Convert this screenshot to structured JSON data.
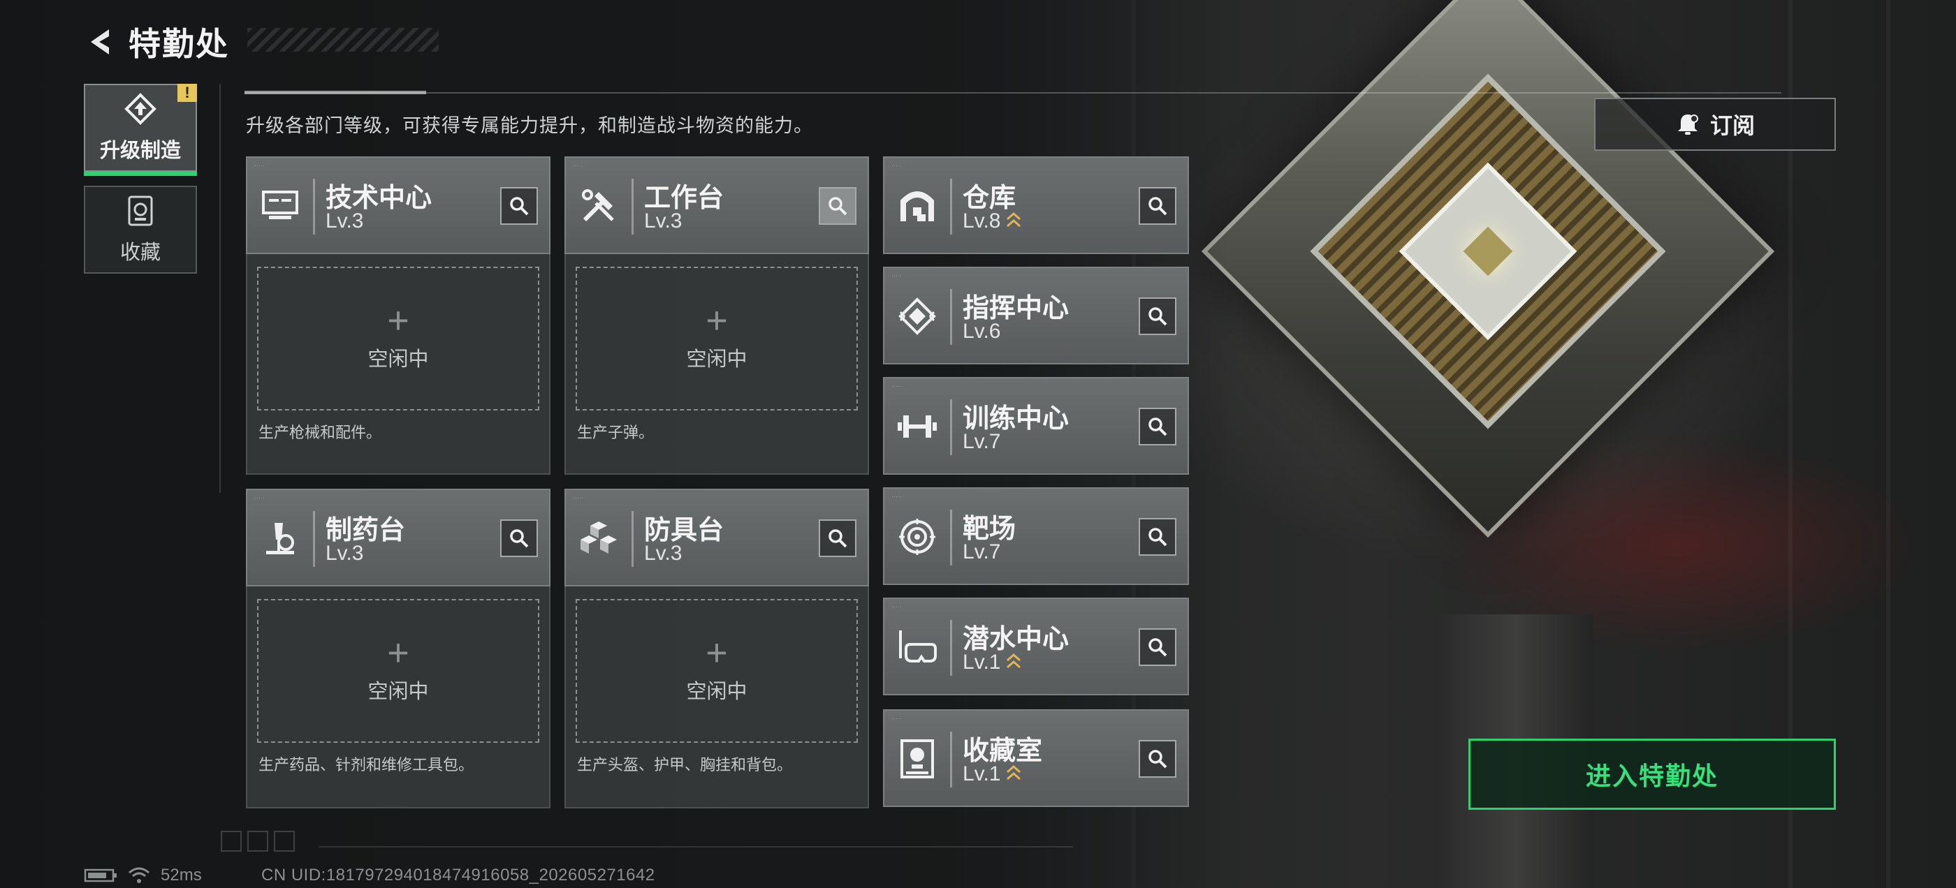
{
  "header": {
    "title": "特勤处"
  },
  "tabs": [
    {
      "label": "升级制造",
      "badge": "!"
    },
    {
      "label": "收藏"
    }
  ],
  "description": "升级各部门等级，可获得专属能力提升，和制造战斗物资的能力。",
  "subscribe_label": "订阅",
  "production_cards": [
    {
      "name": "技术中心",
      "level": "Lv.3",
      "status": "空闲中",
      "desc": "生产枪械和配件。",
      "icon": "monitor-icon"
    },
    {
      "name": "工作台",
      "level": "Lv.3",
      "status": "空闲中",
      "desc": "生产子弹。",
      "icon": "tools-icon"
    },
    {
      "name": "制药台",
      "level": "Lv.3",
      "status": "空闲中",
      "desc": "生产药品、针剂和维修工具包。",
      "icon": "microscope-icon"
    },
    {
      "name": "防具台",
      "level": "Lv.3",
      "status": "空闲中",
      "desc": "生产头盔、护甲、胸挂和背包。",
      "icon": "cubes-icon"
    }
  ],
  "facilities": [
    {
      "name": "仓库",
      "level": "Lv.8",
      "upgradable": true,
      "icon": "warehouse-icon"
    },
    {
      "name": "指挥中心",
      "level": "Lv.6",
      "upgradable": false,
      "icon": "command-icon"
    },
    {
      "name": "训练中心",
      "level": "Lv.7",
      "upgradable": false,
      "icon": "dumbbell-icon"
    },
    {
      "name": "靶场",
      "level": "Lv.7",
      "upgradable": false,
      "icon": "target-icon"
    },
    {
      "name": "潜水中心",
      "level": "Lv.1",
      "upgradable": true,
      "icon": "diving-mask-icon"
    },
    {
      "name": "收藏室",
      "level": "Lv.1",
      "upgradable": true,
      "icon": "trophy-case-icon"
    }
  ],
  "enter_label": "进入特勤处",
  "status_bar": {
    "ping": "52ms",
    "uid": "CN UID:18179729401847491605­8_202605271642"
  },
  "colors": {
    "accent": "#2fd06e",
    "badge": "#e7c65a",
    "upgrade": "#e2b45a"
  }
}
